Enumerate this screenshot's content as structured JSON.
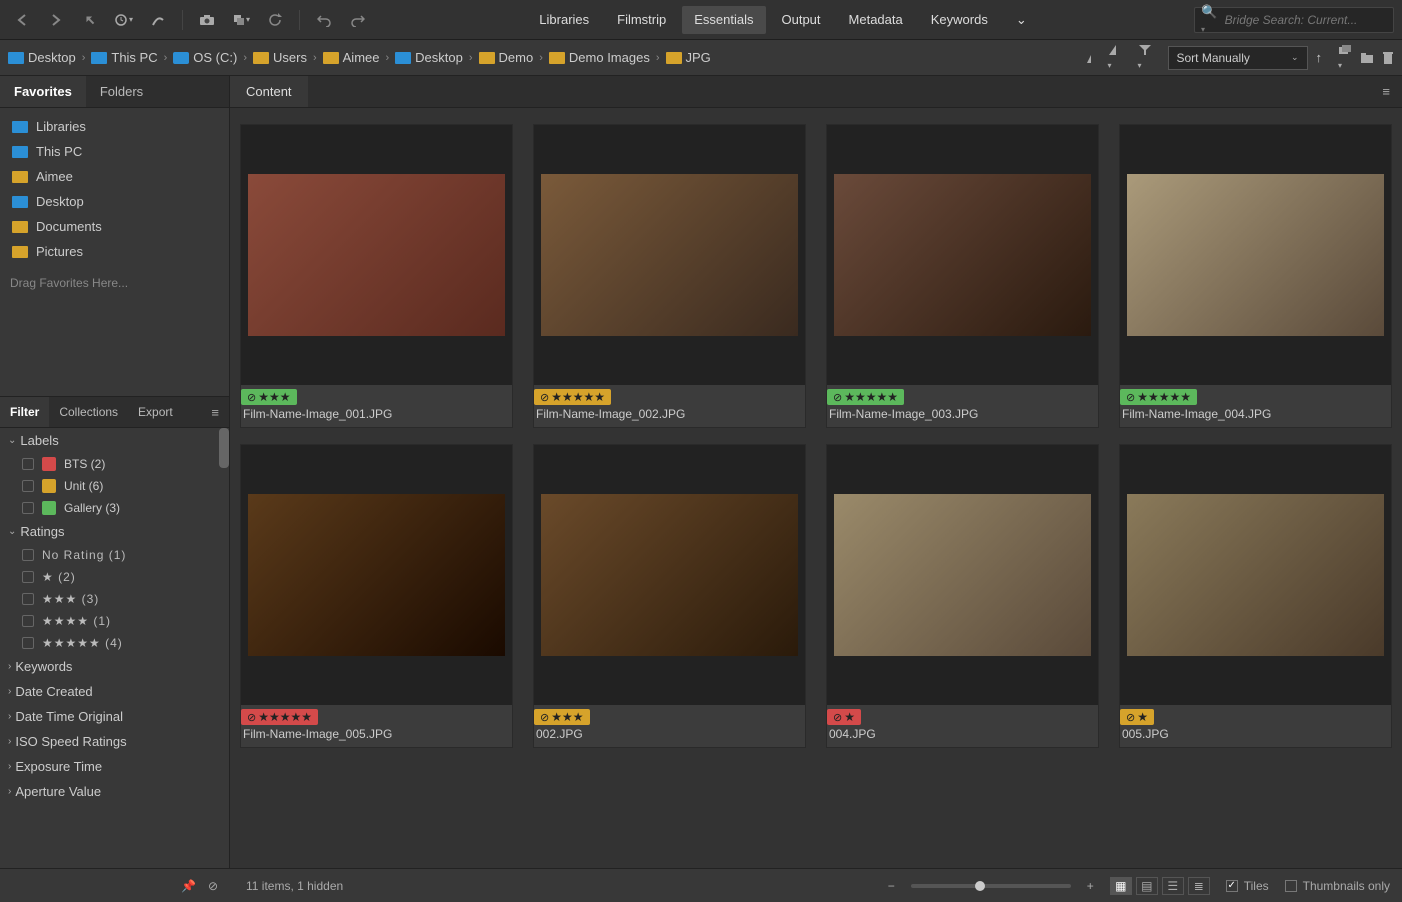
{
  "workspaces": [
    "Libraries",
    "Filmstrip",
    "Essentials",
    "Output",
    "Metadata",
    "Keywords"
  ],
  "activeWorkspace": "Essentials",
  "search": {
    "placeholder": "Bridge Search: Current..."
  },
  "breadcrumbs": [
    {
      "label": "Desktop",
      "icon": "blue"
    },
    {
      "label": "This PC",
      "icon": "blue"
    },
    {
      "label": "OS (C:)",
      "icon": "drive"
    },
    {
      "label": "Users",
      "icon": "yellow"
    },
    {
      "label": "Aimee",
      "icon": "yellow"
    },
    {
      "label": "Desktop",
      "icon": "blue"
    },
    {
      "label": "Demo",
      "icon": "yellow"
    },
    {
      "label": "Demo Images",
      "icon": "yellow"
    },
    {
      "label": "JPG",
      "icon": "yellow"
    }
  ],
  "sort": {
    "label": "Sort Manually"
  },
  "favoritesTabs": [
    "Favorites",
    "Folders"
  ],
  "activeFavTab": "Favorites",
  "favorites": [
    {
      "label": "Libraries",
      "icon": "blue"
    },
    {
      "label": "This PC",
      "icon": "blue"
    },
    {
      "label": "Aimee",
      "icon": "yellow"
    },
    {
      "label": "Desktop",
      "icon": "blue"
    },
    {
      "label": "Documents",
      "icon": "yellow"
    },
    {
      "label": "Pictures",
      "icon": "yellow"
    }
  ],
  "favHint": "Drag Favorites Here...",
  "filterTabs": [
    "Filter",
    "Collections",
    "Export"
  ],
  "activeFilterTab": "Filter",
  "filterSections": {
    "labels": {
      "title": "Labels",
      "items": [
        {
          "swatch": "#d44a4a",
          "name": "BTS",
          "count": "(2)"
        },
        {
          "swatch": "#d6a32b",
          "name": "Unit",
          "count": "(6)"
        },
        {
          "swatch": "#5cb85c",
          "name": "Gallery",
          "count": "(3)"
        }
      ]
    },
    "ratings": {
      "title": "Ratings",
      "items": [
        {
          "stars": "No Rating",
          "count": "(1)"
        },
        {
          "stars": "★",
          "count": "(2)"
        },
        {
          "stars": "★★★",
          "count": "(3)"
        },
        {
          "stars": "★★★★",
          "count": "(1)"
        },
        {
          "stars": "★★★★★",
          "count": "(4)"
        }
      ]
    },
    "collapsed": [
      "Keywords",
      "Date Created",
      "Date Time Original",
      "ISO Speed Ratings",
      "Exposure Time",
      "Aperture Value"
    ]
  },
  "contentTab": "Content",
  "thumbs": [
    {
      "name": "Film-Name-Image_001.JPG",
      "rating": 3,
      "color": "#5cb85c",
      "grad": "linear-gradient(135deg,#8a4a3a,#5a2a1f)"
    },
    {
      "name": "Film-Name-Image_002.JPG",
      "rating": 5,
      "color": "#d6a32b",
      "grad": "linear-gradient(135deg,#7a5a3a,#3a2a1f)"
    },
    {
      "name": "Film-Name-Image_003.JPG",
      "rating": 5,
      "color": "#5cb85c",
      "grad": "linear-gradient(135deg,#6a4a3a,#2a1a0f)"
    },
    {
      "name": "Film-Name-Image_004.JPG",
      "rating": 5,
      "color": "#5cb85c",
      "grad": "linear-gradient(135deg,#aa9a7a,#5a4a3a)"
    },
    {
      "name": "Film-Name-Image_005.JPG",
      "rating": 5,
      "color": "#d44a4a",
      "grad": "linear-gradient(135deg,#5a3a1a,#1a0a00)"
    },
    {
      "name": "002.JPG",
      "rating": 3,
      "color": "#d6a32b",
      "grad": "linear-gradient(135deg,#6a4a2a,#2a1a0a)"
    },
    {
      "name": "004.JPG",
      "rating": 1,
      "color": "#d44a4a",
      "grad": "linear-gradient(135deg,#9a8a6a,#5a4a3a)"
    },
    {
      "name": "005.JPG",
      "rating": 1,
      "color": "#d6a32b",
      "grad": "linear-gradient(135deg,#8a7a5a,#4a3a2a)"
    }
  ],
  "status": {
    "text": "11 items,  1 hidden"
  },
  "viewOptions": {
    "tiles": "Tiles",
    "thumbsOnly": "Thumbnails only"
  }
}
